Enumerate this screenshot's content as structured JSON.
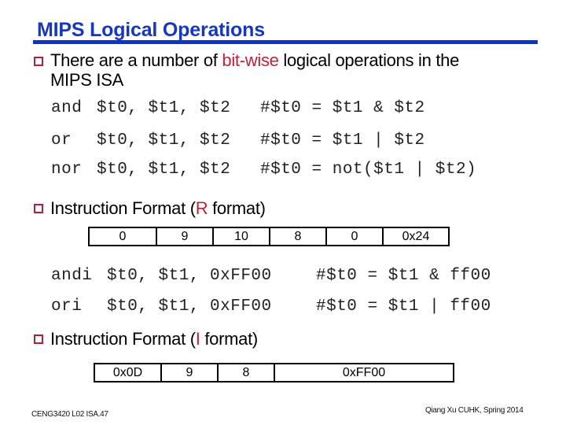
{
  "title": "MIPS Logical Operations",
  "colors": {
    "title": "#1637bf",
    "accent_red": "#c0203a",
    "bullet": "#b0203a"
  },
  "bullets": [
    {
      "icon": "hollow-square-bullet-icon",
      "pre": "There are a number of ",
      "highlight": "bit-wise",
      "post": " logical operations in the",
      "line2": "MIPS ISA"
    },
    {
      "icon": "hollow-square-bullet-icon",
      "pre": "Instruction Format (",
      "highlight": "R",
      "post": " format)"
    },
    {
      "icon": "hollow-square-bullet-icon",
      "pre": "Instruction Format (",
      "highlight": "I",
      "post": " format)"
    }
  ],
  "r_code": [
    {
      "op": "and",
      "args": "$t0, $t1, $t2",
      "comment": "#$t0 = $t1 & $t2"
    },
    {
      "op": "or",
      "args": "$t0, $t1, $t2",
      "comment": "#$t0 = $t1 | $t2"
    },
    {
      "op": "nor",
      "args": "$t0, $t1, $t2",
      "comment": "#$t0 = not($t1 | $t2)"
    }
  ],
  "r_format": [
    "0",
    "9",
    "10",
    "8",
    "0",
    "0x24"
  ],
  "i_code": [
    {
      "op": "andi",
      "args": "$t0, $t1, 0xFF00",
      "comment": "#$t0 = $t1 & ff00"
    },
    {
      "op": "ori",
      "args": "$t0, $t1, 0xFF00",
      "comment": "#$t0 = $t1 | ff00"
    }
  ],
  "i_format": [
    "0x0D",
    "9",
    "8",
    "0xFF00"
  ],
  "footer": {
    "left": "CENG3420 L02 ISA.47",
    "right": "Qiang Xu  CUHK, Spring 2014"
  }
}
